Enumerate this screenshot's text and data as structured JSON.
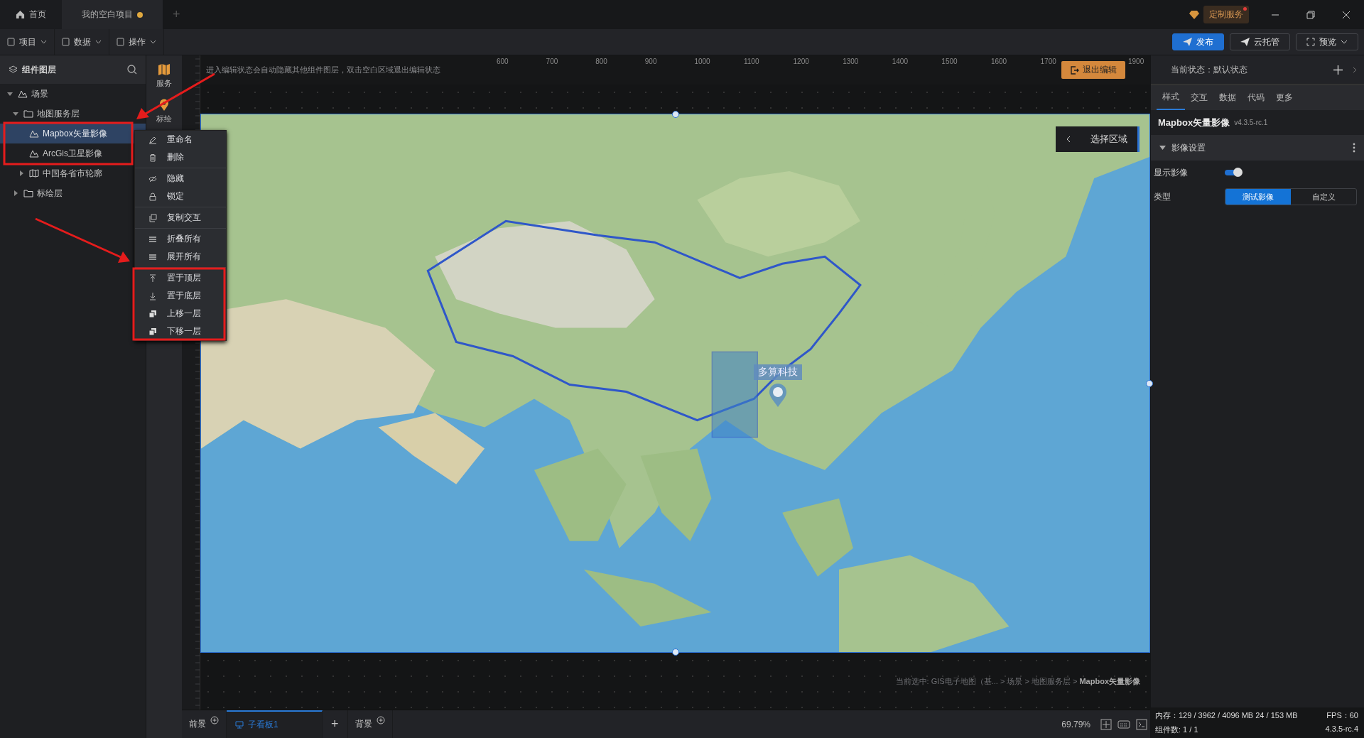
{
  "title_bar": {
    "tabs": [
      {
        "label": "首页",
        "selected": false,
        "unsaved": false
      },
      {
        "label": "我的空白项目",
        "selected": true,
        "unsaved": true
      }
    ],
    "new_tab": "+",
    "custom_service": "定制服务"
  },
  "toolbar": {
    "menus": [
      "项目",
      "数据",
      "操作"
    ],
    "actions": [
      {
        "label": "发布",
        "selected": true
      },
      {
        "label": "云托管",
        "selected": false
      },
      {
        "label": "预览",
        "selected": false
      }
    ]
  },
  "layers_panel": {
    "title": "组件图层",
    "tree": [
      {
        "label": "场景",
        "kind": "scene",
        "expanded": true,
        "selected": false,
        "children": [
          {
            "label": "地图服务层",
            "kind": "folder",
            "expanded": true,
            "selected": false,
            "children": [
              {
                "label": "Mapbox矢量影像",
                "kind": "layer",
                "selected": true
              },
              {
                "label": "ArcGis卫星影像",
                "kind": "layer",
                "selected": false
              },
              {
                "label": "中国各省市轮廓",
                "kind": "map",
                "expanded": false,
                "selected": false
              }
            ]
          },
          {
            "label": "标绘层",
            "kind": "folder",
            "expanded": false,
            "selected": false
          }
        ]
      }
    ]
  },
  "side_tools": [
    "服务",
    "标绘"
  ],
  "context_menu": [
    [
      "重命名",
      "删除"
    ],
    [
      "隐藏",
      "锁定"
    ],
    [
      "复制交互"
    ],
    [
      "折叠所有",
      "展开所有"
    ],
    [
      "置于顶层",
      "置于底层",
      "上移一层",
      "下移一层"
    ]
  ],
  "canvas": {
    "hint": "进入编辑状态会自动隐藏其他组件图层，双击空白区域退出编辑状态",
    "ruler": [
      "600",
      "700",
      "800",
      "900",
      "1000",
      "1100",
      "1200",
      "1300",
      "1400",
      "1500",
      "1600",
      "1700"
    ],
    "exit_button": "退出编辑",
    "ruler_end": [
      "1900"
    ],
    "select_area": "选择区域",
    "marker_label": "多算科技",
    "breadcrumb": "当前选中: GIS电子地图（基... > 场景 > 地图服务层 > **Mapbox矢量影像**"
  },
  "bottom_tabs": [
    {
      "label": "前景",
      "kind": "fixed",
      "selected": false
    },
    {
      "label": "子看板1",
      "kind": "board",
      "selected": true
    },
    {
      "label": "+",
      "kind": "add",
      "selected": false
    },
    {
      "label": "背景",
      "kind": "fixed",
      "selected": false
    }
  ],
  "zoom": "69.79%",
  "props_panel": {
    "state_label": "当前状态：默认状态",
    "tabs": [
      {
        "label": "样式",
        "selected": true
      },
      {
        "label": "交互",
        "selected": false
      },
      {
        "label": "数据",
        "selected": false
      },
      {
        "label": "代码",
        "selected": false
      },
      {
        "label": "更多",
        "selected": false
      }
    ],
    "component": "Mapbox矢量影像",
    "version": "v4.3.5-rc.1",
    "section": "影像设置",
    "show_label": "显示影像",
    "show_on": true,
    "type_label": "类型",
    "type_options": [
      {
        "label": "测试影像",
        "selected": true
      },
      {
        "label": "自定义",
        "selected": false
      }
    ]
  },
  "status": {
    "memory": "内存：129 / 3962 / 4096 MB  24 / 153 MB",
    "fps": "FPS：60",
    "count": "组件数: 1 / 1",
    "version": "4.3.5-rc.4"
  }
}
